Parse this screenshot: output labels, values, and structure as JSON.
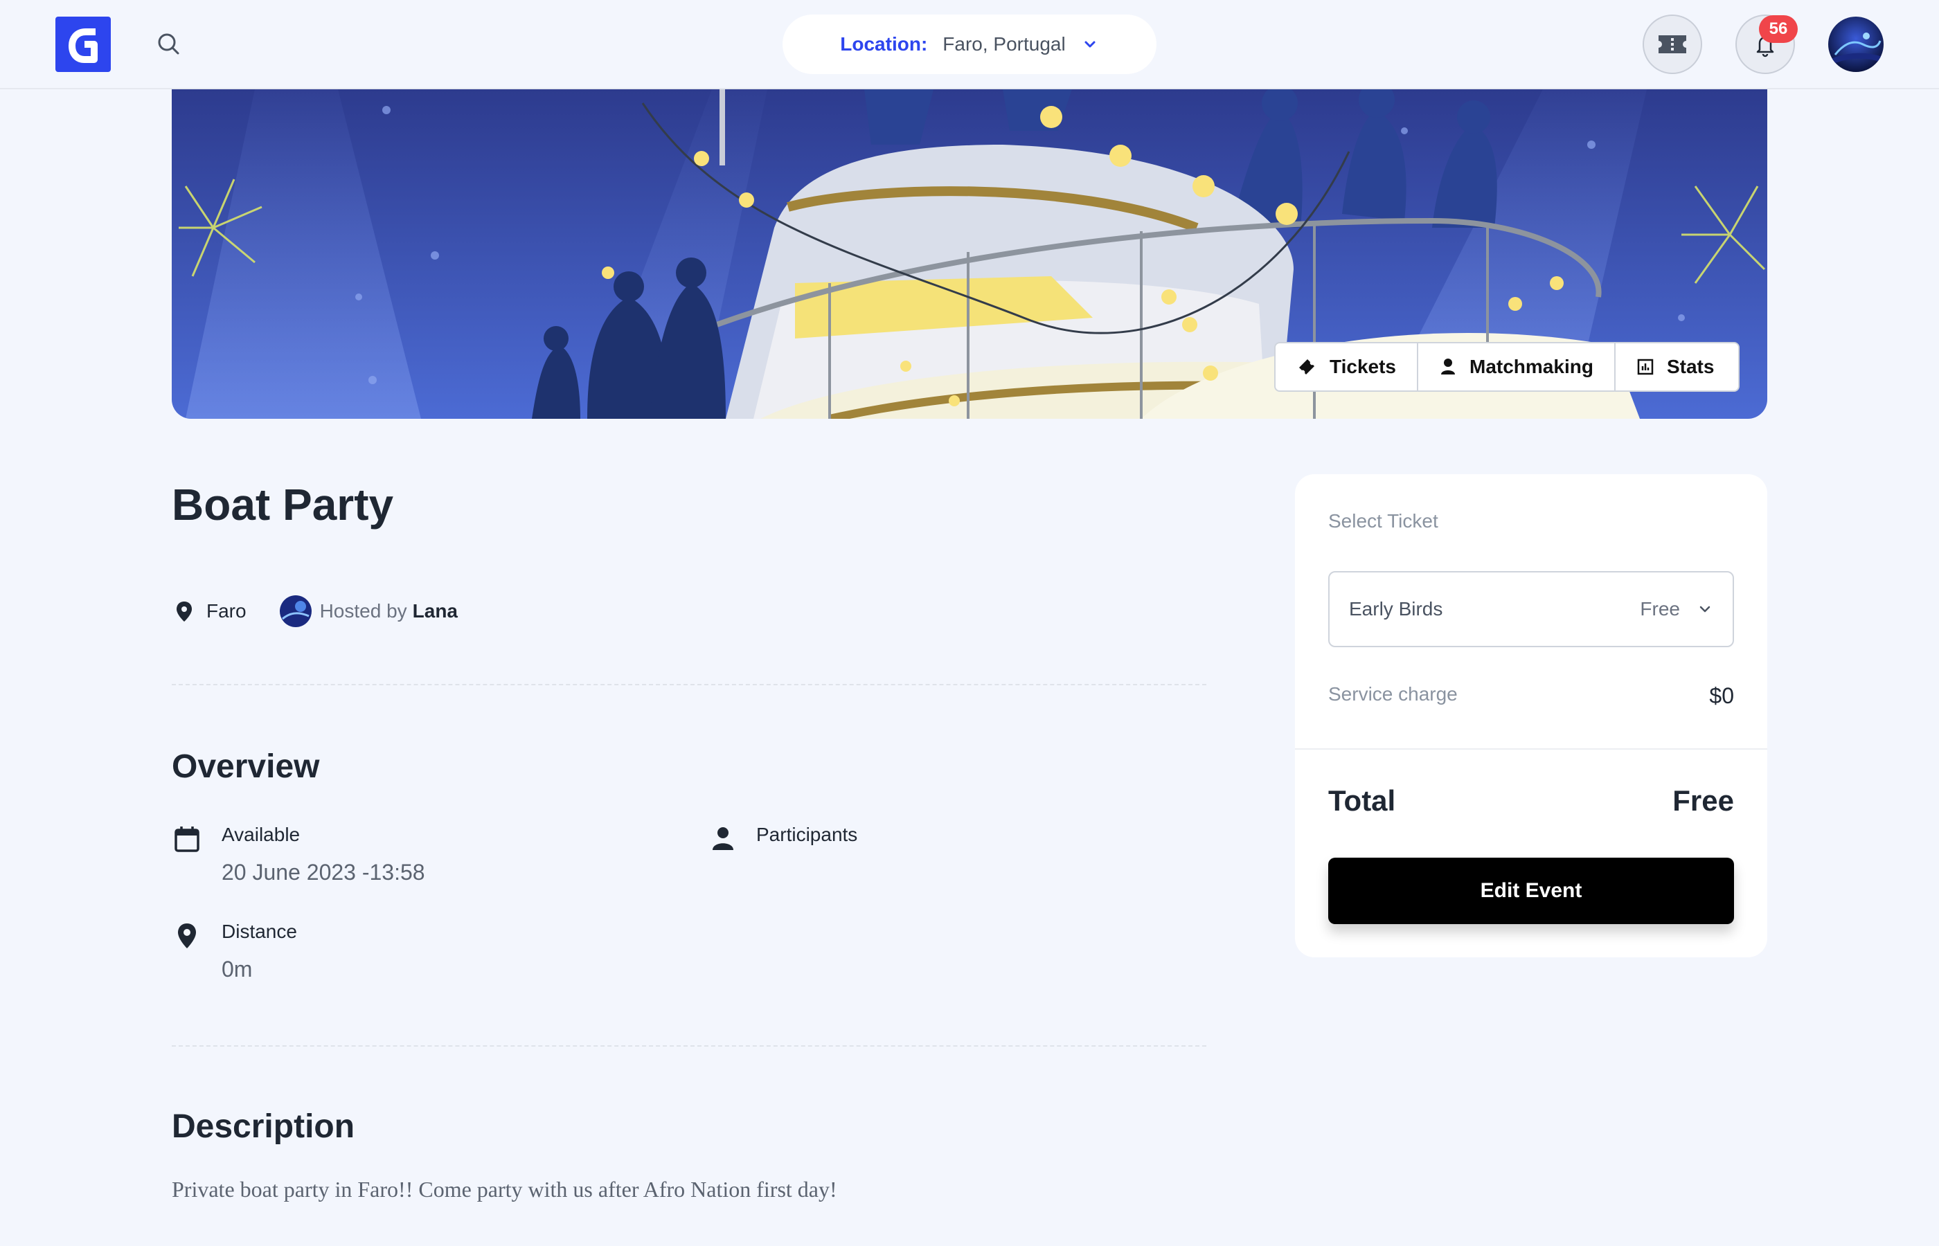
{
  "header": {
    "location_label": "Location:",
    "location_value": "Faro, Portugal",
    "notification_count": "56"
  },
  "banner": {
    "tabs": [
      {
        "label": "Tickets",
        "icon": "ticket-icon"
      },
      {
        "label": "Matchmaking",
        "icon": "person-icon"
      },
      {
        "label": "Stats",
        "icon": "stats-icon"
      }
    ]
  },
  "event": {
    "title": "Boat Party",
    "city": "Faro",
    "hosted_by_label": "Hosted by",
    "host_name": "Lana"
  },
  "overview": {
    "title": "Overview",
    "available_label": "Available",
    "available_value": "20 June 2023 -13:58",
    "participants_label": "Participants",
    "distance_label": "Distance",
    "distance_value": "0m"
  },
  "description": {
    "title": "Description",
    "text": "Private boat party in Faro!! Come party with us after Afro Nation first day!"
  },
  "ticket_card": {
    "select_label": "Select Ticket",
    "ticket_name": "Early Birds",
    "ticket_price": "Free",
    "service_label": "Service charge",
    "service_value": "$0",
    "total_label": "Total",
    "total_value": "Free",
    "edit_button": "Edit Event"
  },
  "colors": {
    "brand": "#2d45ee",
    "badge": "#f0454a",
    "background": "#f3f6fd"
  }
}
